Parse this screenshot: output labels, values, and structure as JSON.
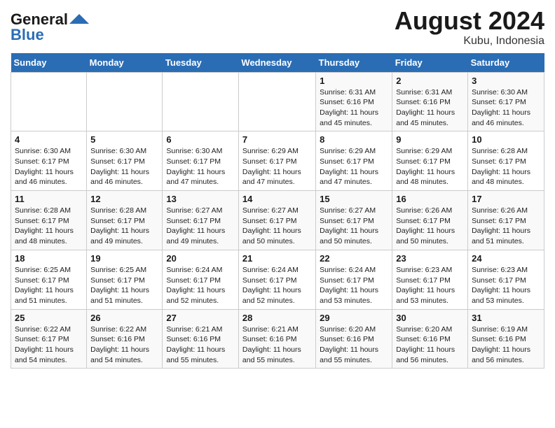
{
  "logo": {
    "line1": "General",
    "line2": "Blue"
  },
  "title": "August 2024",
  "subtitle": "Kubu, Indonesia",
  "days_of_week": [
    "Sunday",
    "Monday",
    "Tuesday",
    "Wednesday",
    "Thursday",
    "Friday",
    "Saturday"
  ],
  "weeks": [
    [
      {
        "day": "",
        "info": ""
      },
      {
        "day": "",
        "info": ""
      },
      {
        "day": "",
        "info": ""
      },
      {
        "day": "",
        "info": ""
      },
      {
        "day": "1",
        "info": "Sunrise: 6:31 AM\nSunset: 6:16 PM\nDaylight: 11 hours\nand 45 minutes."
      },
      {
        "day": "2",
        "info": "Sunrise: 6:31 AM\nSunset: 6:16 PM\nDaylight: 11 hours\nand 45 minutes."
      },
      {
        "day": "3",
        "info": "Sunrise: 6:30 AM\nSunset: 6:17 PM\nDaylight: 11 hours\nand 46 minutes."
      }
    ],
    [
      {
        "day": "4",
        "info": "Sunrise: 6:30 AM\nSunset: 6:17 PM\nDaylight: 11 hours\nand 46 minutes."
      },
      {
        "day": "5",
        "info": "Sunrise: 6:30 AM\nSunset: 6:17 PM\nDaylight: 11 hours\nand 46 minutes."
      },
      {
        "day": "6",
        "info": "Sunrise: 6:30 AM\nSunset: 6:17 PM\nDaylight: 11 hours\nand 47 minutes."
      },
      {
        "day": "7",
        "info": "Sunrise: 6:29 AM\nSunset: 6:17 PM\nDaylight: 11 hours\nand 47 minutes."
      },
      {
        "day": "8",
        "info": "Sunrise: 6:29 AM\nSunset: 6:17 PM\nDaylight: 11 hours\nand 47 minutes."
      },
      {
        "day": "9",
        "info": "Sunrise: 6:29 AM\nSunset: 6:17 PM\nDaylight: 11 hours\nand 48 minutes."
      },
      {
        "day": "10",
        "info": "Sunrise: 6:28 AM\nSunset: 6:17 PM\nDaylight: 11 hours\nand 48 minutes."
      }
    ],
    [
      {
        "day": "11",
        "info": "Sunrise: 6:28 AM\nSunset: 6:17 PM\nDaylight: 11 hours\nand 48 minutes."
      },
      {
        "day": "12",
        "info": "Sunrise: 6:28 AM\nSunset: 6:17 PM\nDaylight: 11 hours\nand 49 minutes."
      },
      {
        "day": "13",
        "info": "Sunrise: 6:27 AM\nSunset: 6:17 PM\nDaylight: 11 hours\nand 49 minutes."
      },
      {
        "day": "14",
        "info": "Sunrise: 6:27 AM\nSunset: 6:17 PM\nDaylight: 11 hours\nand 50 minutes."
      },
      {
        "day": "15",
        "info": "Sunrise: 6:27 AM\nSunset: 6:17 PM\nDaylight: 11 hours\nand 50 minutes."
      },
      {
        "day": "16",
        "info": "Sunrise: 6:26 AM\nSunset: 6:17 PM\nDaylight: 11 hours\nand 50 minutes."
      },
      {
        "day": "17",
        "info": "Sunrise: 6:26 AM\nSunset: 6:17 PM\nDaylight: 11 hours\nand 51 minutes."
      }
    ],
    [
      {
        "day": "18",
        "info": "Sunrise: 6:25 AM\nSunset: 6:17 PM\nDaylight: 11 hours\nand 51 minutes."
      },
      {
        "day": "19",
        "info": "Sunrise: 6:25 AM\nSunset: 6:17 PM\nDaylight: 11 hours\nand 51 minutes."
      },
      {
        "day": "20",
        "info": "Sunrise: 6:24 AM\nSunset: 6:17 PM\nDaylight: 11 hours\nand 52 minutes."
      },
      {
        "day": "21",
        "info": "Sunrise: 6:24 AM\nSunset: 6:17 PM\nDaylight: 11 hours\nand 52 minutes."
      },
      {
        "day": "22",
        "info": "Sunrise: 6:24 AM\nSunset: 6:17 PM\nDaylight: 11 hours\nand 53 minutes."
      },
      {
        "day": "23",
        "info": "Sunrise: 6:23 AM\nSunset: 6:17 PM\nDaylight: 11 hours\nand 53 minutes."
      },
      {
        "day": "24",
        "info": "Sunrise: 6:23 AM\nSunset: 6:17 PM\nDaylight: 11 hours\nand 53 minutes."
      }
    ],
    [
      {
        "day": "25",
        "info": "Sunrise: 6:22 AM\nSunset: 6:17 PM\nDaylight: 11 hours\nand 54 minutes."
      },
      {
        "day": "26",
        "info": "Sunrise: 6:22 AM\nSunset: 6:16 PM\nDaylight: 11 hours\nand 54 minutes."
      },
      {
        "day": "27",
        "info": "Sunrise: 6:21 AM\nSunset: 6:16 PM\nDaylight: 11 hours\nand 55 minutes."
      },
      {
        "day": "28",
        "info": "Sunrise: 6:21 AM\nSunset: 6:16 PM\nDaylight: 11 hours\nand 55 minutes."
      },
      {
        "day": "29",
        "info": "Sunrise: 6:20 AM\nSunset: 6:16 PM\nDaylight: 11 hours\nand 55 minutes."
      },
      {
        "day": "30",
        "info": "Sunrise: 6:20 AM\nSunset: 6:16 PM\nDaylight: 11 hours\nand 56 minutes."
      },
      {
        "day": "31",
        "info": "Sunrise: 6:19 AM\nSunset: 6:16 PM\nDaylight: 11 hours\nand 56 minutes."
      }
    ]
  ]
}
